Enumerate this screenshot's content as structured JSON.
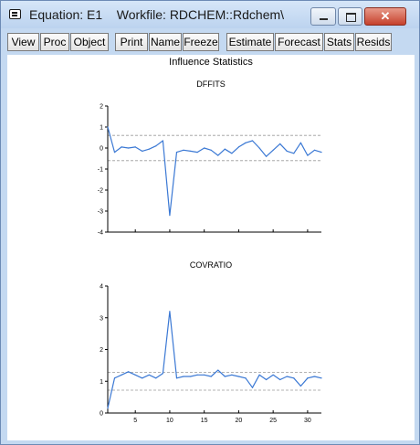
{
  "window": {
    "title": "Equation: E1    Workfile: RDCHEM::Rdchem\\",
    "icons": [
      "system-menu-icon",
      "minimize-icon",
      "maximize-icon",
      "close-icon"
    ]
  },
  "toolbar": {
    "buttons": [
      "View",
      "Proc",
      "Object",
      "Print",
      "Name",
      "Freeze",
      "Estimate",
      "Forecast",
      "Stats",
      "Resids"
    ]
  },
  "content": {
    "title": "Influence Statistics"
  },
  "colors": {
    "line": "#3a78d4",
    "axis": "#000000",
    "reference": "#9a9a9a",
    "window_frame": "#c4d9f1"
  },
  "chart_data": [
    {
      "type": "line",
      "title": "DFFITS",
      "x": [
        1,
        2,
        3,
        4,
        5,
        6,
        7,
        8,
        9,
        10,
        11,
        12,
        13,
        14,
        15,
        16,
        17,
        18,
        19,
        20,
        21,
        22,
        23,
        24,
        25,
        26,
        27,
        28,
        29,
        30,
        31,
        32
      ],
      "values": [
        1.0,
        -0.2,
        0.05,
        0.0,
        0.05,
        -0.15,
        -0.05,
        0.1,
        0.35,
        -3.2,
        -0.2,
        -0.1,
        -0.15,
        -0.2,
        0.0,
        -0.1,
        -0.35,
        -0.05,
        -0.25,
        0.05,
        0.25,
        0.35,
        0.0,
        -0.4,
        -0.1,
        0.2,
        -0.15,
        -0.25,
        0.25,
        -0.35,
        -0.1,
        -0.2
      ],
      "reference_lines": [
        0.6,
        -0.6
      ],
      "ylim": [
        -4,
        2
      ],
      "yticks": [
        2,
        1,
        0,
        -1,
        -2,
        -3,
        -4
      ],
      "xlim": [
        1,
        32
      ],
      "xticks": [
        5,
        10,
        15,
        20,
        25,
        30
      ]
    },
    {
      "type": "line",
      "title": "COVRATIO",
      "x": [
        1,
        2,
        3,
        4,
        5,
        6,
        7,
        8,
        9,
        10,
        11,
        12,
        13,
        14,
        15,
        16,
        17,
        18,
        19,
        20,
        21,
        22,
        23,
        24,
        25,
        26,
        27,
        28,
        29,
        30,
        31,
        32
      ],
      "values": [
        0.15,
        1.1,
        1.2,
        1.3,
        1.2,
        1.1,
        1.2,
        1.1,
        1.25,
        3.2,
        1.1,
        1.15,
        1.15,
        1.2,
        1.2,
        1.15,
        1.35,
        1.15,
        1.2,
        1.15,
        1.1,
        0.8,
        1.2,
        1.05,
        1.2,
        1.05,
        1.15,
        1.1,
        0.85,
        1.1,
        1.15,
        1.1
      ],
      "reference_lines": [
        1.28,
        0.72
      ],
      "ylim": [
        0,
        4
      ],
      "yticks": [
        4,
        3,
        2,
        1,
        0
      ],
      "xlim": [
        1,
        32
      ],
      "xticks": [
        5,
        10,
        15,
        20,
        25,
        30
      ]
    }
  ]
}
